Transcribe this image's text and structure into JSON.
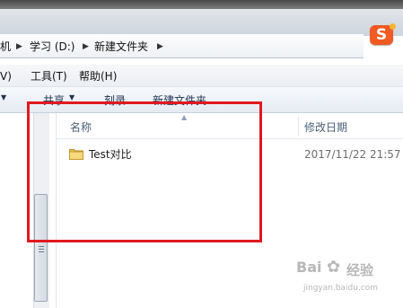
{
  "address_bar": {
    "crumbs": [
      "机",
      "学习 (D:)",
      "新建文件夹"
    ]
  },
  "menu_bar": {
    "items": [
      "V)",
      "工具(T)",
      "帮助(H)"
    ]
  },
  "toolbar": {
    "share_label": "共享",
    "burn_label": "刻录",
    "new_folder_label": "新建文件夹"
  },
  "file_list": {
    "columns": [
      "名称",
      "修改日期"
    ],
    "rows": [
      {
        "name": "Test对比",
        "modified": "2017/11/22 21:57",
        "type_icon": "folder-icon"
      }
    ]
  },
  "annotation": {
    "color": "#e0191f"
  },
  "watermark": {
    "text_a": "Bai",
    "text_b": "经验",
    "text_c": "jingyan.baidu.com"
  },
  "colors": {
    "accent_orange": "#f15a22",
    "toolbar_text": "#1e3250"
  }
}
